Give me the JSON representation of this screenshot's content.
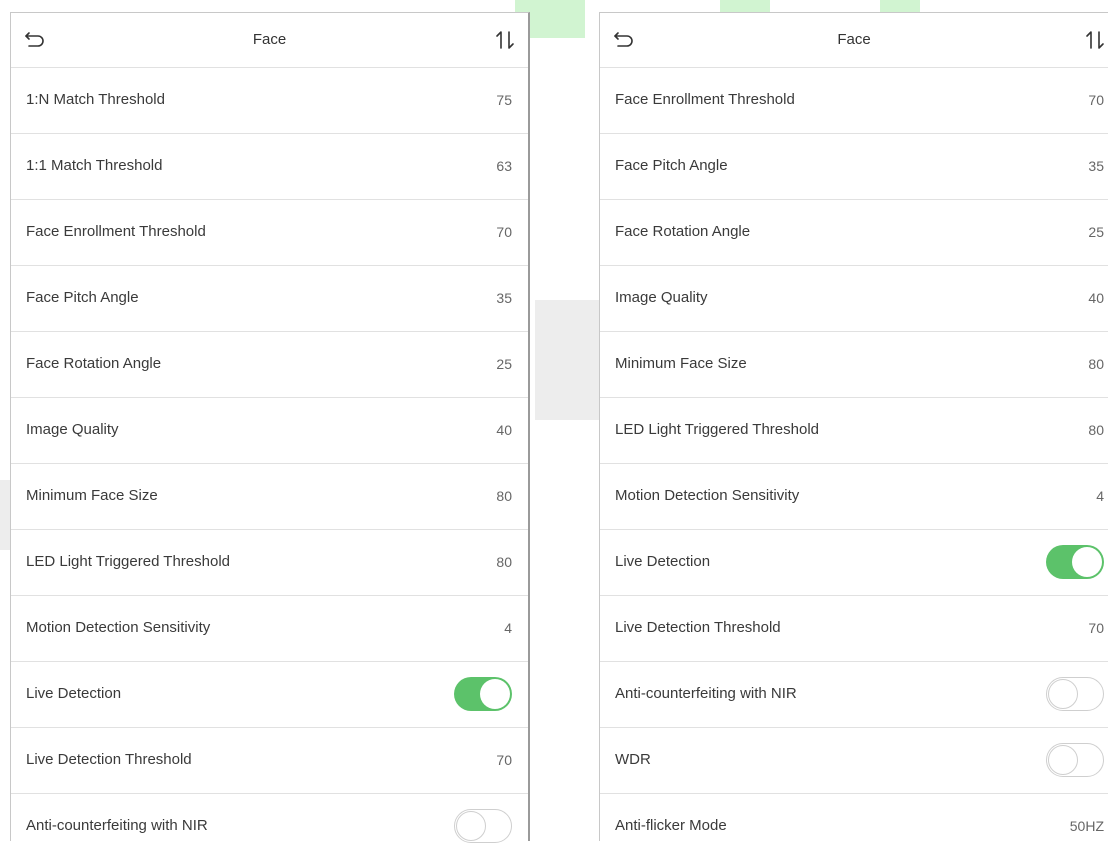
{
  "left_screen": {
    "title": "Face",
    "icons": {
      "back": "back-arrow-icon",
      "sort": "sort-icon"
    },
    "rows": [
      {
        "label": "1:N Match Threshold",
        "value": "75"
      },
      {
        "label": "1:1 Match Threshold",
        "value": "63"
      },
      {
        "label": "Face Enrollment Threshold",
        "value": "70"
      },
      {
        "label": "Face Pitch Angle",
        "value": "35"
      },
      {
        "label": "Face Rotation Angle",
        "value": "25"
      },
      {
        "label": "Image Quality",
        "value": "40"
      },
      {
        "label": "Minimum Face Size",
        "value": "80"
      },
      {
        "label": "LED Light Triggered Threshold",
        "value": "80"
      },
      {
        "label": "Motion Detection Sensitivity",
        "value": "4"
      },
      {
        "label": "Live Detection",
        "toggle": true
      },
      {
        "label": "Live Detection Threshold",
        "value": "70"
      },
      {
        "label": "Anti-counterfeiting with NIR",
        "toggle": false
      }
    ]
  },
  "right_screen": {
    "title": "Face",
    "icons": {
      "back": "back-arrow-icon",
      "sort": "sort-icon"
    },
    "rows": [
      {
        "label": "Face Enrollment Threshold",
        "value": "70"
      },
      {
        "label": "Face Pitch Angle",
        "value": "35"
      },
      {
        "label": "Face Rotation Angle",
        "value": "25"
      },
      {
        "label": "Image Quality",
        "value": "40"
      },
      {
        "label": "Minimum Face Size",
        "value": "80"
      },
      {
        "label": "LED Light Triggered Threshold",
        "value": "80"
      },
      {
        "label": "Motion Detection Sensitivity",
        "value": "4"
      },
      {
        "label": "Live Detection",
        "toggle": true
      },
      {
        "label": "Live Detection Threshold",
        "value": "70"
      },
      {
        "label": "Anti-counterfeiting with NIR",
        "toggle": false
      },
      {
        "label": "WDR",
        "toggle": false
      },
      {
        "label": "Anti-flicker Mode",
        "value": "50HZ"
      }
    ]
  },
  "colors": {
    "toggle_on": "#5cc26a",
    "divider": "#e1e1e1",
    "text": "#3a3a3a",
    "value": "#666666"
  }
}
